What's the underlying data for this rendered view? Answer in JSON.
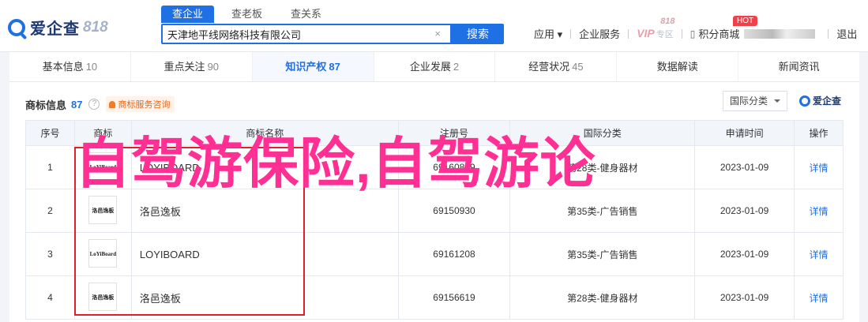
{
  "header": {
    "logo_text": "爱企查",
    "logo_suffix": "818",
    "search_tabs": [
      "查企业",
      "查老板",
      "查关系"
    ],
    "search_value": "天津地平线网络科技有限公司",
    "search_clear": "×",
    "search_button": "搜索",
    "nav": {
      "app": "应用",
      "service": "企业服务",
      "vip": "VIP",
      "vip_zone": "专区",
      "vip_badge": "818",
      "points": "积分商城",
      "hot": "HOT",
      "logout": "退出"
    }
  },
  "tabs": [
    {
      "label": "基本信息",
      "count": "10"
    },
    {
      "label": "重点关注",
      "count": "90"
    },
    {
      "label": "知识产权",
      "count": "87"
    },
    {
      "label": "企业发展",
      "count": "2"
    },
    {
      "label": "经营状况",
      "count": "45"
    },
    {
      "label": "数据解读",
      "count": ""
    },
    {
      "label": "新闻资讯",
      "count": ""
    }
  ],
  "section": {
    "title": "商标信息",
    "count": "87",
    "help": "?",
    "consult": "商标服务咨询",
    "filter": "国际分类",
    "mini_logo": "爱企查"
  },
  "table": {
    "headers": [
      "序号",
      "商标",
      "商标名称",
      "注册号",
      "国际分类",
      "申请时间",
      "操作"
    ],
    "rows": [
      {
        "no": "1",
        "img": "LoYiBoard",
        "name": "LOYIBOARD",
        "reg": "69160879",
        "cls": "第28类-健身器材",
        "date": "2023-01-09",
        "action": "详情"
      },
      {
        "no": "2",
        "img": "洛邑逸板",
        "name": "洛邑逸板",
        "reg": "69150930",
        "cls": "第35类-广告销售",
        "date": "2023-01-09",
        "action": "详情"
      },
      {
        "no": "3",
        "img": "LoYiBoard",
        "name": "LOYIBOARD",
        "reg": "69161208",
        "cls": "第35类-广告销售",
        "date": "2023-01-09",
        "action": "详情"
      },
      {
        "no": "4",
        "img": "洛邑逸板",
        "name": "洛邑逸板",
        "reg": "69156619",
        "cls": "第28类-健身器材",
        "date": "2023-01-09",
        "action": "详情"
      }
    ]
  },
  "overlay": {
    "text": "自驾游保险,自驾游论",
    "color": "#ff2f93",
    "box_color": "#e31e2c"
  },
  "colors": {
    "accent": "#1f6fe5"
  }
}
